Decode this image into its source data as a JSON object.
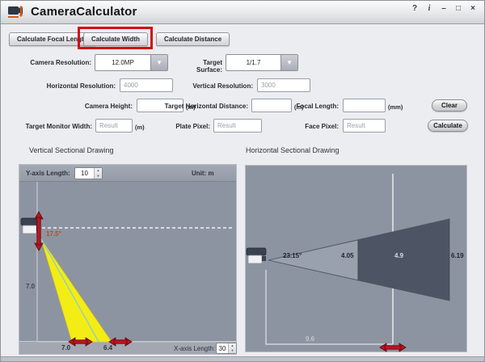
{
  "titlebar": {
    "title": "CameraCalculator",
    "controls": {
      "help": "?",
      "info": "i",
      "minimize": "–",
      "maximize": "□",
      "close": "×"
    }
  },
  "tabs": [
    {
      "label": "Calculate Focal Length",
      "active": false
    },
    {
      "label": "Calculate Width",
      "active": true
    },
    {
      "label": "Calculate Distance",
      "active": false
    }
  ],
  "form": {
    "camera_resolution": {
      "label": "Camera Resolution:",
      "value": "12.0MP"
    },
    "target_surface": {
      "label": "Target Surface:",
      "value": "1/1.7"
    },
    "horizontal_resolution": {
      "label": "Horizontal Resolution:",
      "value": "4000"
    },
    "vertical_resolution": {
      "label": "Vertical Resolution:",
      "value": "3000"
    },
    "camera_height": {
      "label": "Camera Height:",
      "unit": "(m)",
      "value": ""
    },
    "target_horizontal_distance": {
      "label": "Target Horizontal Distance:",
      "unit": "(m)",
      "value": ""
    },
    "focal_length": {
      "label": "Focal Length:",
      "unit": "(mm)",
      "value": ""
    },
    "target_monitor_width": {
      "label": "Target Monitor Width:",
      "unit": "(m)",
      "placeholder": "Result"
    },
    "plate_pixel": {
      "label": "Plate Pixel:",
      "placeholder": "Result"
    },
    "face_pixel": {
      "label": "Face Pixel:",
      "placeholder": "Result"
    },
    "clear_button": "Clear",
    "calculate_button": "Calculate"
  },
  "vertical_drawing": {
    "title": "Vertical Sectional Drawing",
    "y_axis_label": "Y-axis Length:",
    "y_axis_value": "10",
    "unit_label": "Unit: m",
    "angle": "17.5°",
    "y_tick": "7.0",
    "ground_near": "7.0",
    "ground_width": "6.4",
    "x_axis_label": "X-axis Length:",
    "x_axis_value": "30"
  },
  "horizontal_drawing": {
    "title": "Horizontal Sectional Drawing",
    "angle": "23.15°",
    "width_near": "4.05",
    "width_mid": "4.9",
    "width_far": "6.19",
    "distance": "9.6"
  },
  "colors": {
    "tab_highlight_red": "#d40a12",
    "cone_yellow": "#f4ec15",
    "panel_gray": "#8d94a1",
    "cone_dark": "#4d5565",
    "arrow_red": "#bc1420",
    "angle_text_red": "#cc4412"
  }
}
